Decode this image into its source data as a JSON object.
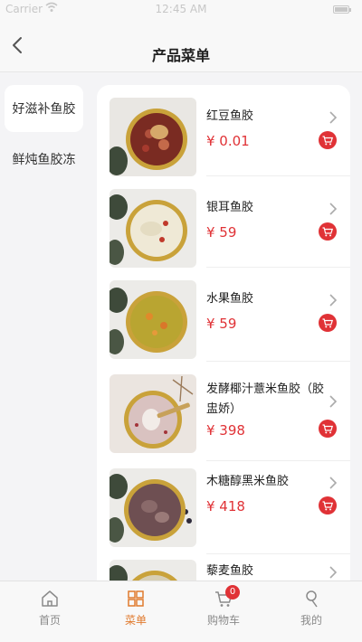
{
  "status_bar": {
    "carrier": "Carrier",
    "time": "12:45 AM"
  },
  "nav": {
    "title": "产品菜单"
  },
  "categories": [
    {
      "label": "好滋补鱼胶",
      "active": true
    },
    {
      "label": "鲜炖鱼胶冻",
      "active": false
    }
  ],
  "products": [
    {
      "name": "红豆鱼胶",
      "price": "¥ 0.01"
    },
    {
      "name": "银耳鱼胶",
      "price": "¥ 59"
    },
    {
      "name": "水果鱼胶",
      "price": "¥ 59"
    },
    {
      "name": "发酵椰汁薏米鱼胶（胶盅娇）",
      "price": "¥ 398"
    },
    {
      "name": "木糖醇黑米鱼胶",
      "price": "¥ 418"
    },
    {
      "name": "藜麦鱼胶",
      "price": ""
    }
  ],
  "tabs": [
    {
      "label": "首页",
      "icon": "home-icon"
    },
    {
      "label": "菜单",
      "icon": "menu-grid-icon"
    },
    {
      "label": "购物车",
      "icon": "cart-icon",
      "badge": "0"
    },
    {
      "label": "我的",
      "icon": "user-icon"
    }
  ],
  "colors": {
    "accent": "#e03236",
    "tab_active": "#e07a2e",
    "background": "#f4f4f6"
  }
}
